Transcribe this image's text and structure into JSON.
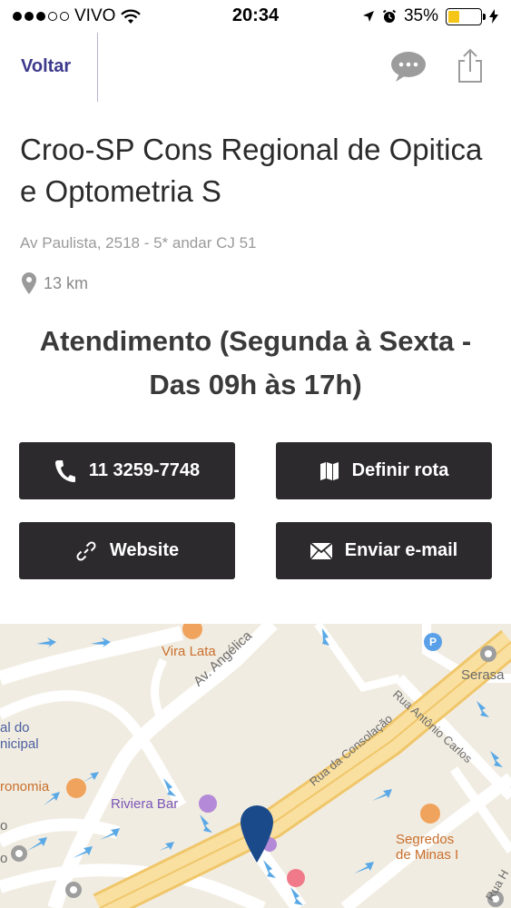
{
  "status_bar": {
    "carrier": "VIVO",
    "time": "20:34",
    "battery_percent": "35%",
    "battery_level": 0.35
  },
  "nav": {
    "back_label": "Voltar",
    "chat_icon": "speech-bubble-icon",
    "share_icon": "share-icon"
  },
  "place": {
    "title": "Croo-SP Cons Regional de Opitica e Optometria S",
    "address": "Av Paulista, 2518 - 5* andar CJ 51",
    "distance": "13 km",
    "hours": "Atendimento (Segunda à Sexta - Das 09h às 17h)"
  },
  "actions": {
    "phone_label": "11 3259-7748",
    "route_label": "Definir rota",
    "website_label": "Website",
    "email_label": "Enviar e-mail"
  },
  "map": {
    "labels": {
      "vira_lata": "Vira Lata",
      "av_angelica": "Av. Angélica",
      "rua_consolacao": "Rua da Consolação",
      "rua_antonio_carlos": "Rua Antônio Carlos",
      "serasa": "Serasa",
      "al_do": "al do",
      "nicipal": "nicipal",
      "ronomia": "ronomia",
      "riviera_bar": "Riviera Bar",
      "segredos": "Segredos",
      "de_minas": "de Minas I",
      "o_1": "o",
      "o_2": "o",
      "rua_h": "Rua H"
    },
    "colors": {
      "background": "#f1ece1",
      "highway": "#f7d98a",
      "pin": "#1b4a8a"
    }
  }
}
